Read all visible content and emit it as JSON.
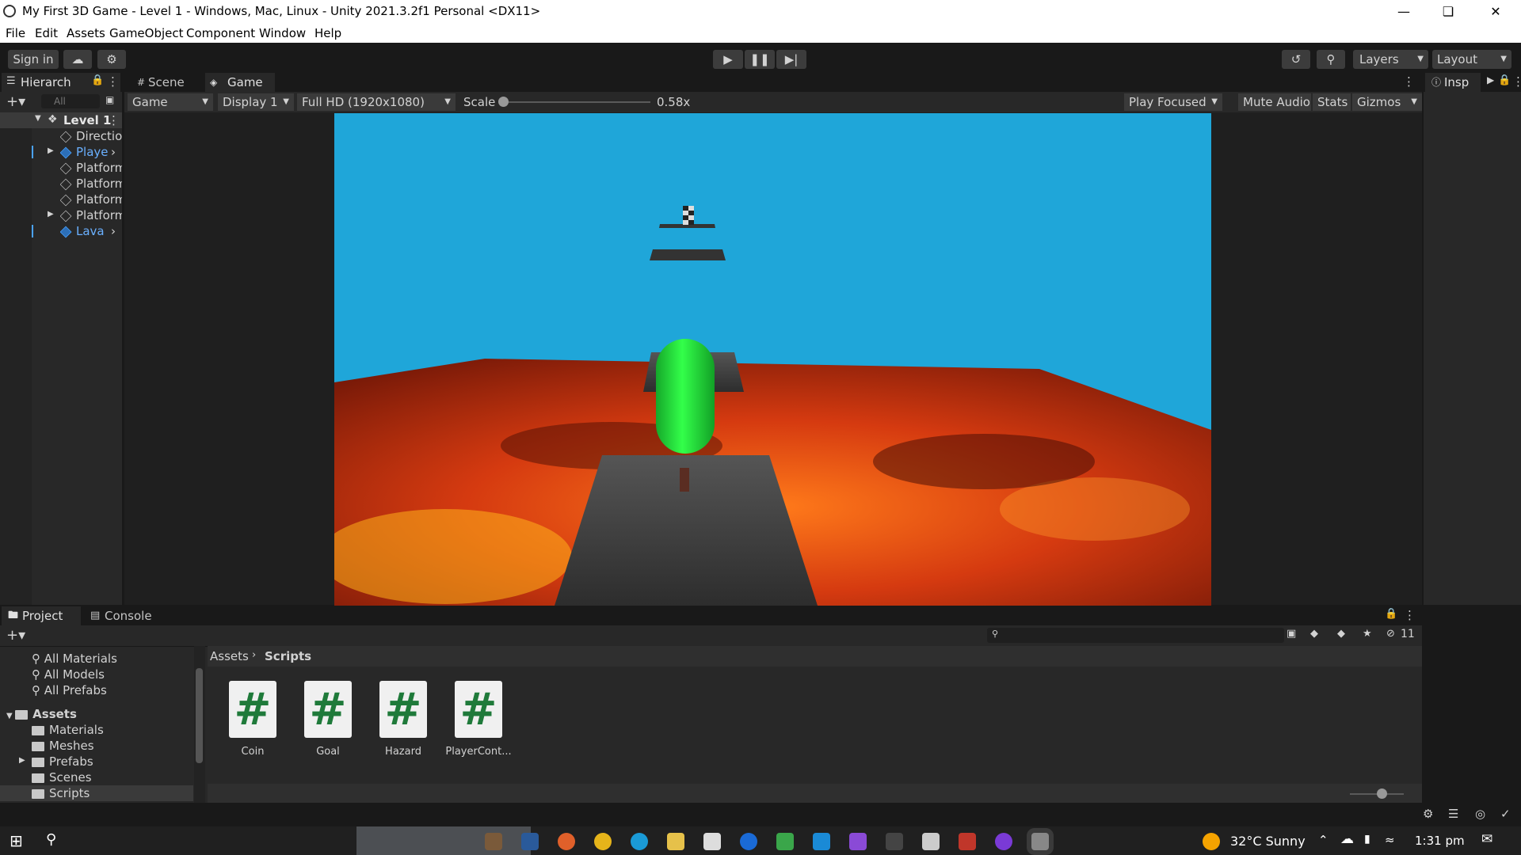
{
  "window": {
    "title": "My First 3D Game - Level 1 - Windows, Mac, Linux - Unity 2021.3.2f1 Personal <DX11>"
  },
  "menu": [
    "File",
    "Edit",
    "Assets",
    "GameObject",
    "Component",
    "Window",
    "Help"
  ],
  "toolbar": {
    "sign_in": "Sign in",
    "layers": "Layers",
    "layout": "Layout"
  },
  "hierarchy": {
    "tab": "Hierarch",
    "search_placeholder": "All",
    "root": "Level 1",
    "items": [
      {
        "label": "Directio",
        "prefab": false,
        "expandable": false
      },
      {
        "label": "Playe",
        "prefab": true,
        "expandable": true
      },
      {
        "label": "Platform",
        "prefab": false,
        "expandable": false
      },
      {
        "label": "Platform",
        "prefab": false,
        "expandable": false
      },
      {
        "label": "Platform",
        "prefab": false,
        "expandable": false
      },
      {
        "label": "Platform",
        "prefab": false,
        "expandable": true
      },
      {
        "label": "Lava",
        "prefab": true,
        "expandable": false
      }
    ]
  },
  "view_tabs": {
    "scene": "Scene",
    "game": "Game"
  },
  "game_bar": {
    "mode": "Game",
    "display": "Display 1",
    "resolution": "Full HD (1920x1080)",
    "scale_label": "Scale",
    "scale_value": "0.58x",
    "scale_fraction": 0.0,
    "play_focused": "Play Focused",
    "mute": "Mute Audio",
    "stats": "Stats",
    "gizmos": "Gizmos"
  },
  "inspector": {
    "tab": "Insp"
  },
  "bottom_tabs": {
    "project": "Project",
    "console": "Console"
  },
  "project": {
    "favorites": [
      "All Materials",
      "All Models",
      "All Prefabs"
    ],
    "assets_root": "Assets",
    "folders": [
      "Materials",
      "Meshes",
      "Prefabs",
      "Scenes",
      "Scripts"
    ],
    "selected_folder": "Scripts",
    "breadcrumb": [
      "Assets",
      "Scripts"
    ],
    "hidden_count": "11",
    "scripts": [
      "Coin",
      "Goal",
      "Hazard",
      "PlayerCont..."
    ]
  },
  "taskbar": {
    "weather": "32°C  Sunny",
    "time": "1:31 pm"
  },
  "colors": {
    "sky": "#1fa6d9",
    "player": "#1ee03a",
    "lava": "#c6320f",
    "platform": "#3c3c3c"
  }
}
